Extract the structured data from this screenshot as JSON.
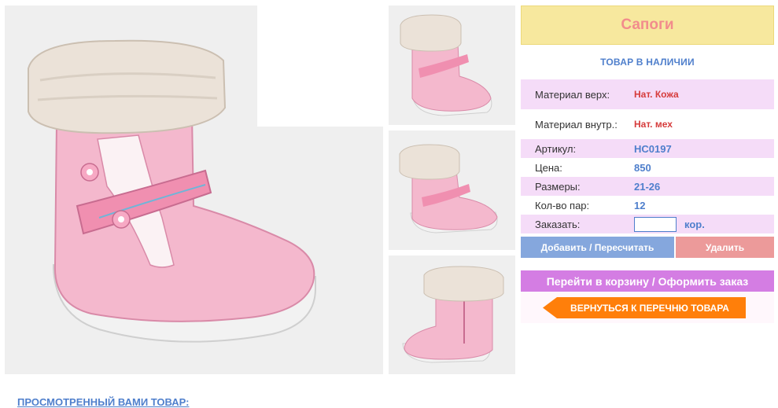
{
  "product": {
    "title": "Сапоги",
    "stock_status": "ТОВАР В НАЛИЧИИ"
  },
  "specs": [
    {
      "label": "Материал верх:",
      "value": "Нат. Кожа"
    },
    {
      "label": "Материал внутр.:",
      "value": "Нат. мех"
    },
    {
      "label": "Артикул:",
      "value": "HC0197"
    },
    {
      "label": "Цена:",
      "value": "850"
    },
    {
      "label": "Размеры:",
      "value": "21-26"
    },
    {
      "label": "Кол-во пар:",
      "value": "12"
    }
  ],
  "order": {
    "label": "Заказать:",
    "input_value": "",
    "unit": "кор."
  },
  "buttons": {
    "add": "Добавить / Пересчитать",
    "delete": "Удалить",
    "cart": "Перейти в корзину / Оформить заказ",
    "back": "ВЕРНУТЬСЯ К ПЕРЕЧНЮ ТОВАРА"
  },
  "recent_heading": "ПРОСМОТРЕННЫЙ ВАМИ ТОВАР:",
  "colors": {
    "accent_blue": "#4f7fcc",
    "title_bg": "#f7e89e",
    "row_pink": "#f5dcf8",
    "cart_purple": "#d47de3",
    "back_orange": "#ff7f0a"
  }
}
